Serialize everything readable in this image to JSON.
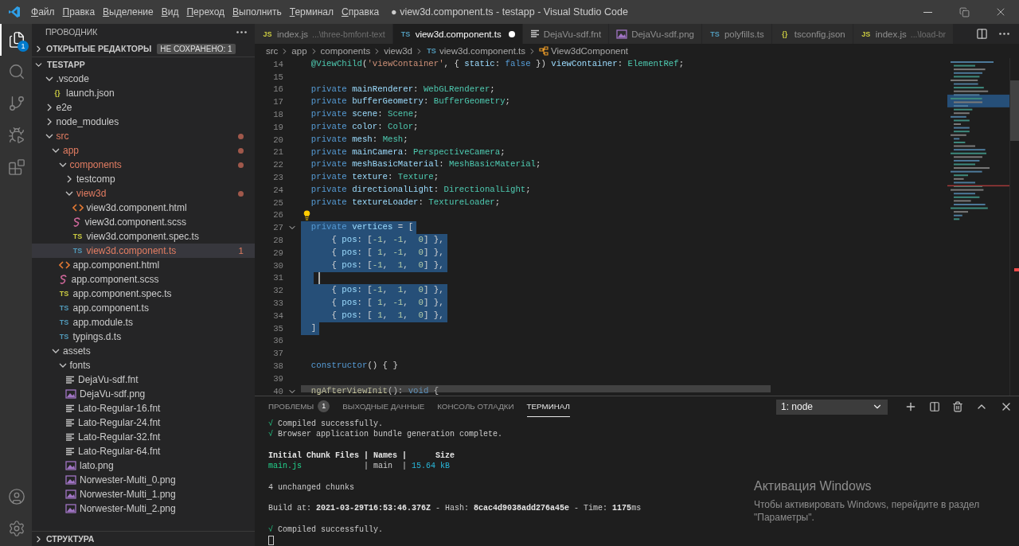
{
  "window": {
    "title": "● view3d.component.ts - testapp - Visual Studio Code"
  },
  "menu": [
    "Файл",
    "Правка",
    "Выделение",
    "Вид",
    "Переход",
    "Выполнить",
    "Терминал",
    "Справка"
  ],
  "activity": [
    {
      "kind": "explorer",
      "selected": true,
      "badge": "1"
    },
    {
      "kind": "search",
      "selected": false
    },
    {
      "kind": "scm",
      "selected": false
    },
    {
      "kind": "debug",
      "selected": false
    },
    {
      "kind": "extensions",
      "selected": false
    }
  ],
  "activity_bottom": [
    {
      "kind": "account"
    },
    {
      "kind": "settings"
    }
  ],
  "sidebar": {
    "title": "ПРОВОДНИК",
    "open_editors": {
      "label": "ОТКРЫТЫЕ РЕДАКТОРЫ",
      "expanded": false,
      "badge": "НЕ СОХРАНЕНО: 1"
    },
    "root": {
      "name": "TESTAPP",
      "expanded": true
    },
    "items": [
      {
        "name": ".vscode",
        "kind": "folder",
        "expanded": true,
        "modified": false,
        "selected": false,
        "children": [
          {
            "name": "launch.json",
            "kind": "json",
            "tag": "{}",
            "modified": false,
            "selected": false
          }
        ]
      },
      {
        "name": "e2e",
        "kind": "folder",
        "expanded": false,
        "modified": false,
        "selected": false
      },
      {
        "name": "node_modules",
        "kind": "folder",
        "expanded": false,
        "modified": false,
        "selected": false
      },
      {
        "name": "src",
        "kind": "folder",
        "expanded": true,
        "modified": true,
        "selected": false,
        "children": [
          {
            "name": "app",
            "kind": "folder",
            "expanded": true,
            "modified": true,
            "selected": false,
            "children": [
              {
                "name": "components",
                "kind": "folder",
                "expanded": true,
                "modified": true,
                "selected": false,
                "children": [
                  {
                    "name": "testcomp",
                    "kind": "folder",
                    "expanded": false,
                    "modified": false,
                    "selected": false
                  },
                  {
                    "name": "view3d",
                    "kind": "folder",
                    "expanded": true,
                    "modified": true,
                    "selected": false,
                    "children": [
                      {
                        "name": "view3d.component.html",
                        "kind": "html",
                        "modified": false,
                        "selected": false
                      },
                      {
                        "name": "view3d.component.scss",
                        "kind": "scss",
                        "modified": false,
                        "selected": false
                      },
                      {
                        "name": "view3d.component.spec.ts",
                        "kind": "spec",
                        "tag": "TS",
                        "modified": false,
                        "selected": false
                      },
                      {
                        "name": "view3d.component.ts",
                        "kind": "ts",
                        "tag": "TS",
                        "modified": true,
                        "selected": true,
                        "problems": "1"
                      }
                    ]
                  }
                ]
              },
              {
                "name": "app.component.html",
                "kind": "html",
                "modified": false,
                "selected": false
              },
              {
                "name": "app.component.scss",
                "kind": "scss",
                "modified": false,
                "selected": false
              },
              {
                "name": "app.component.spec.ts",
                "kind": "spec",
                "tag": "TS",
                "modified": false,
                "selected": false
              },
              {
                "name": "app.component.ts",
                "kind": "ts",
                "tag": "TS",
                "modified": false,
                "selected": false
              },
              {
                "name": "app.module.ts",
                "kind": "ts",
                "tag": "TS",
                "modified": false,
                "selected": false
              },
              {
                "name": "typings.d.ts",
                "kind": "ts",
                "tag": "TS",
                "modified": false,
                "selected": false
              }
            ]
          },
          {
            "name": "assets",
            "kind": "folder",
            "expanded": true,
            "modified": false,
            "selected": false,
            "children": [
              {
                "name": "fonts",
                "kind": "folder",
                "expanded": true,
                "modified": false,
                "selected": false,
                "children": [
                  {
                    "name": "DejaVu-sdf.fnt",
                    "kind": "fnt",
                    "modified": false,
                    "selected": false
                  },
                  {
                    "name": "DejaVu-sdf.png",
                    "kind": "png",
                    "modified": false,
                    "selected": false
                  },
                  {
                    "name": "Lato-Regular-16.fnt",
                    "kind": "fnt",
                    "modified": false,
                    "selected": false
                  },
                  {
                    "name": "Lato-Regular-24.fnt",
                    "kind": "fnt",
                    "modified": false,
                    "selected": false
                  },
                  {
                    "name": "Lato-Regular-32.fnt",
                    "kind": "fnt",
                    "modified": false,
                    "selected": false
                  },
                  {
                    "name": "Lato-Regular-64.fnt",
                    "kind": "fnt",
                    "modified": false,
                    "selected": false
                  },
                  {
                    "name": "lato.png",
                    "kind": "png",
                    "modified": false,
                    "selected": false
                  },
                  {
                    "name": "Norwester-Multi_0.png",
                    "kind": "png",
                    "modified": false,
                    "selected": false
                  },
                  {
                    "name": "Norwester-Multi_1.png",
                    "kind": "png",
                    "modified": false,
                    "selected": false
                  },
                  {
                    "name": "Norwester-Multi_2.png",
                    "kind": "png",
                    "modified": false,
                    "selected": false
                  }
                ]
              }
            ]
          }
        ]
      }
    ],
    "outline": {
      "label": "СТРУКТУРА",
      "expanded": false
    }
  },
  "tabs": [
    {
      "kind": "js",
      "tag": "JS",
      "label": "index.js",
      "hint": "...\\three-bmfont-text",
      "selected": false,
      "dirty": false
    },
    {
      "kind": "ts",
      "tag": "TS",
      "label": "view3d.component.ts",
      "selected": true,
      "dirty": true
    },
    {
      "kind": "fnt",
      "label": "DejaVu-sdf.fnt",
      "selected": false,
      "dirty": false
    },
    {
      "kind": "png",
      "label": "DejaVu-sdf.png",
      "selected": false,
      "dirty": false
    },
    {
      "kind": "ts",
      "tag": "TS",
      "label": "polyfills.ts",
      "selected": false,
      "dirty": false
    },
    {
      "kind": "json",
      "tag": "{}",
      "label": "tsconfig.json",
      "selected": false,
      "dirty": false
    },
    {
      "kind": "js",
      "tag": "JS",
      "label": "index.js",
      "hint": "...\\load-br",
      "selected": false,
      "dirty": false
    }
  ],
  "breadcrumbs": [
    {
      "kind": "folder",
      "label": "src"
    },
    {
      "kind": "folder",
      "label": "app"
    },
    {
      "kind": "folder",
      "label": "components"
    },
    {
      "kind": "folder",
      "label": "view3d"
    },
    {
      "kind": "file",
      "tag": "TS",
      "label": "view3d.component.ts"
    },
    {
      "kind": "class",
      "label": "View3dComponent"
    }
  ],
  "code": [
    {
      "number": "14",
      "selected": false,
      "segments": [
        {
          "kind": "type",
          "text": "@ViewChild"
        },
        {
          "kind": "p",
          "text": "("
        },
        {
          "kind": "str",
          "text": "'viewContainer'"
        },
        {
          "kind": "p",
          "text": ", {"
        },
        {
          "kind": "var",
          "text": " static"
        },
        {
          "kind": "p",
          "text": ":"
        },
        {
          "kind": "kw",
          "text": " false"
        },
        {
          "kind": "p",
          "text": " })"
        },
        {
          "kind": "var",
          "text": " viewContainer"
        },
        {
          "kind": "p",
          "text": ":"
        },
        {
          "kind": "type",
          "text": " ElementRef"
        },
        {
          "kind": "p",
          "text": ";"
        }
      ]
    },
    {
      "number": "15",
      "selected": false
    },
    {
      "number": "16",
      "selected": false,
      "segments": [
        {
          "kind": "kw",
          "text": "private"
        },
        {
          "kind": "var",
          "text": " mainRenderer"
        },
        {
          "kind": "p",
          "text": ":"
        },
        {
          "kind": "type",
          "text": " WebGLRenderer"
        },
        {
          "kind": "p",
          "text": ";"
        }
      ]
    },
    {
      "number": "17",
      "selected": false,
      "segments": [
        {
          "kind": "kw",
          "text": "private"
        },
        {
          "kind": "var",
          "text": " bufferGeometry"
        },
        {
          "kind": "p",
          "text": ":"
        },
        {
          "kind": "type",
          "text": " BufferGeometry"
        },
        {
          "kind": "p",
          "text": ";"
        }
      ]
    },
    {
      "number": "18",
      "selected": false,
      "segments": [
        {
          "kind": "kw",
          "text": "private"
        },
        {
          "kind": "var",
          "text": " scene"
        },
        {
          "kind": "p",
          "text": ":"
        },
        {
          "kind": "type",
          "text": " Scene"
        },
        {
          "kind": "p",
          "text": ";"
        }
      ]
    },
    {
      "number": "19",
      "selected": false,
      "segments": [
        {
          "kind": "kw",
          "text": "private"
        },
        {
          "kind": "var",
          "text": " color"
        },
        {
          "kind": "p",
          "text": ":"
        },
        {
          "kind": "type",
          "text": " Color"
        },
        {
          "kind": "p",
          "text": ";"
        }
      ]
    },
    {
      "number": "20",
      "selected": false,
      "segments": [
        {
          "kind": "kw",
          "text": "private"
        },
        {
          "kind": "var",
          "text": " mesh"
        },
        {
          "kind": "p",
          "text": ":"
        },
        {
          "kind": "type",
          "text": " Mesh"
        },
        {
          "kind": "p",
          "text": ";"
        }
      ]
    },
    {
      "number": "21",
      "selected": false,
      "segments": [
        {
          "kind": "kw",
          "text": "private"
        },
        {
          "kind": "var",
          "text": " mainCamera"
        },
        {
          "kind": "p",
          "text": ":"
        },
        {
          "kind": "type",
          "text": " PerspectiveCamera"
        },
        {
          "kind": "p",
          "text": ";"
        }
      ]
    },
    {
      "number": "22",
      "selected": false,
      "segments": [
        {
          "kind": "kw",
          "text": "private"
        },
        {
          "kind": "var",
          "text": " meshBasicMaterial"
        },
        {
          "kind": "p",
          "text": ":"
        },
        {
          "kind": "type",
          "text": " MeshBasicMaterial"
        },
        {
          "kind": "p",
          "text": ";"
        }
      ]
    },
    {
      "number": "23",
      "selected": false,
      "segments": [
        {
          "kind": "kw",
          "text": "private"
        },
        {
          "kind": "var",
          "text": " texture"
        },
        {
          "kind": "p",
          "text": ":"
        },
        {
          "kind": "type",
          "text": " Texture"
        },
        {
          "kind": "p",
          "text": ";"
        }
      ]
    },
    {
      "number": "24",
      "selected": false,
      "segments": [
        {
          "kind": "kw",
          "text": "private"
        },
        {
          "kind": "var",
          "text": " directionalLight"
        },
        {
          "kind": "p",
          "text": ":"
        },
        {
          "kind": "type",
          "text": " DirectionalLight"
        },
        {
          "kind": "p",
          "text": ";"
        }
      ]
    },
    {
      "number": "25",
      "selected": false,
      "segments": [
        {
          "kind": "kw",
          "text": "private"
        },
        {
          "kind": "var",
          "text": " textureLoader"
        },
        {
          "kind": "p",
          "text": ":"
        },
        {
          "kind": "type",
          "text": " TextureLoader"
        },
        {
          "kind": "p",
          "text": ";"
        }
      ]
    },
    {
      "number": "26",
      "selected": false,
      "kind": "bulb"
    },
    {
      "number": "27",
      "selected": true,
      "kind": "fold",
      "segments": [
        {
          "kind": "kw",
          "text": "private"
        },
        {
          "kind": "var",
          "text": " vertices"
        },
        {
          "kind": "p",
          "text": " = ["
        }
      ]
    },
    {
      "number": "28",
      "selected": true,
      "segments": [
        {
          "kind": "p",
          "text": "    {"
        },
        {
          "kind": "var",
          "text": " pos"
        },
        {
          "kind": "p",
          "text": ": ["
        },
        {
          "kind": "num",
          "text": "-1"
        },
        {
          "kind": "p",
          "text": ","
        },
        {
          "kind": "num",
          "text": " -1"
        },
        {
          "kind": "p",
          "text": ","
        },
        {
          "kind": "num",
          "text": "  0"
        },
        {
          "kind": "p",
          "text": "] },"
        }
      ]
    },
    {
      "number": "29",
      "selected": true,
      "segments": [
        {
          "kind": "p",
          "text": "    {"
        },
        {
          "kind": "var",
          "text": " pos"
        },
        {
          "kind": "p",
          "text": ": ["
        },
        {
          "kind": "num",
          "text": " 1"
        },
        {
          "kind": "p",
          "text": ","
        },
        {
          "kind": "num",
          "text": " -1"
        },
        {
          "kind": "p",
          "text": ","
        },
        {
          "kind": "num",
          "text": "  0"
        },
        {
          "kind": "p",
          "text": "] },"
        }
      ]
    },
    {
      "number": "30",
      "selected": true,
      "segments": [
        {
          "kind": "p",
          "text": "    {"
        },
        {
          "kind": "var",
          "text": " pos"
        },
        {
          "kind": "p",
          "text": ": ["
        },
        {
          "kind": "num",
          "text": "-1"
        },
        {
          "kind": "p",
          "text": ","
        },
        {
          "kind": "num",
          "text": "  1"
        },
        {
          "kind": "p",
          "text": ","
        },
        {
          "kind": "num",
          "text": "  0"
        },
        {
          "kind": "p",
          "text": "] },"
        }
      ]
    },
    {
      "number": "31",
      "selected": true,
      "kind": "cursor"
    },
    {
      "number": "32",
      "selected": true,
      "segments": [
        {
          "kind": "p",
          "text": "    {"
        },
        {
          "kind": "var",
          "text": " pos"
        },
        {
          "kind": "p",
          "text": ": ["
        },
        {
          "kind": "num",
          "text": "-1"
        },
        {
          "kind": "p",
          "text": ","
        },
        {
          "kind": "num",
          "text": "  1"
        },
        {
          "kind": "p",
          "text": ","
        },
        {
          "kind": "num",
          "text": "  0"
        },
        {
          "kind": "p",
          "text": "] },"
        }
      ]
    },
    {
      "number": "33",
      "selected": true,
      "segments": [
        {
          "kind": "p",
          "text": "    {"
        },
        {
          "kind": "var",
          "text": " pos"
        },
        {
          "kind": "p",
          "text": ": ["
        },
        {
          "kind": "num",
          "text": " 1"
        },
        {
          "kind": "p",
          "text": ","
        },
        {
          "kind": "num",
          "text": " -1"
        },
        {
          "kind": "p",
          "text": ","
        },
        {
          "kind": "num",
          "text": "  0"
        },
        {
          "kind": "p",
          "text": "] },"
        }
      ]
    },
    {
      "number": "34",
      "selected": true,
      "segments": [
        {
          "kind": "p",
          "text": "    {"
        },
        {
          "kind": "var",
          "text": " pos"
        },
        {
          "kind": "p",
          "text": ": ["
        },
        {
          "kind": "num",
          "text": " 1"
        },
        {
          "kind": "p",
          "text": ","
        },
        {
          "kind": "num",
          "text": "  1"
        },
        {
          "kind": "p",
          "text": ","
        },
        {
          "kind": "num",
          "text": "  0"
        },
        {
          "kind": "p",
          "text": "] },"
        }
      ]
    },
    {
      "number": "35",
      "selected": true,
      "segments": [
        {
          "kind": "p",
          "text": "]"
        }
      ]
    },
    {
      "number": "36",
      "selected": false
    },
    {
      "number": "37",
      "selected": false
    },
    {
      "number": "38",
      "selected": false,
      "segments": [
        {
          "kind": "kw",
          "text": "constructor"
        },
        {
          "kind": "p",
          "text": "() { }"
        }
      ]
    },
    {
      "number": "39",
      "selected": false
    },
    {
      "number": "40",
      "selected": false,
      "kind": "fold",
      "segments": [
        {
          "kind": "fn",
          "text": "ngAfterViewInit"
        },
        {
          "kind": "p",
          "text": "():"
        },
        {
          "kind": "kw",
          "text": " void"
        },
        {
          "kind": "p",
          "text": " {"
        }
      ]
    }
  ],
  "panel": {
    "tabs": [
      {
        "label": "ПРОБЛЕМЫ",
        "badge": "1",
        "selected": false
      },
      {
        "label": "ВЫХОДНЫЕ ДАННЫЕ",
        "selected": false
      },
      {
        "label": "КОНСОЛЬ ОТЛАДКИ",
        "selected": false
      },
      {
        "label": "ТЕРМИНАЛ",
        "selected": true
      }
    ],
    "terminal_select": "1: node",
    "lines": [
      {
        "kind": "text",
        "segments": [
          {
            "kind": "ok",
            "text": "√"
          },
          {
            "kind": "p",
            "text": " Compiled successfully."
          }
        ]
      },
      {
        "kind": "text",
        "segments": [
          {
            "kind": "ok",
            "text": "√"
          },
          {
            "kind": "p",
            "text": " Browser application bundle generation complete."
          }
        ]
      },
      {
        "kind": "gap"
      },
      {
        "kind": "text",
        "segments": [
          {
            "kind": "b",
            "text": "Initial Chunk Files | Names |      Size"
          }
        ]
      },
      {
        "kind": "text",
        "segments": [
          {
            "kind": "g",
            "text": "main.js"
          },
          {
            "kind": "p",
            "text": "             | main  |"
          },
          {
            "kind": "c",
            "text": " 15.64 kB"
          }
        ]
      },
      {
        "kind": "gap"
      },
      {
        "kind": "text",
        "segments": [
          {
            "kind": "p",
            "text": "4 unchanged chunks"
          }
        ]
      },
      {
        "kind": "gap"
      },
      {
        "kind": "text",
        "segments": [
          {
            "kind": "p",
            "text": "Build at:"
          },
          {
            "kind": "b",
            "text": " 2021-03-29T16:53:46.376Z"
          },
          {
            "kind": "p",
            "text": " - Hash:"
          },
          {
            "kind": "b",
            "text": " 8cac4d9038add276a45e"
          },
          {
            "kind": "p",
            "text": " - Time:"
          },
          {
            "kind": "b",
            "text": " 1175"
          },
          {
            "kind": "p",
            "text": "ms"
          }
        ]
      },
      {
        "kind": "gap"
      },
      {
        "kind": "text",
        "segments": [
          {
            "kind": "ok",
            "text": "√"
          },
          {
            "kind": "p",
            "text": " Compiled successfully."
          }
        ]
      },
      {
        "kind": "prompt"
      }
    ]
  },
  "activation": {
    "title": "Активация Windows",
    "lines": [
      "Чтобы активировать Windows, перейдите в раздел",
      "\"Параметры\"."
    ]
  }
}
